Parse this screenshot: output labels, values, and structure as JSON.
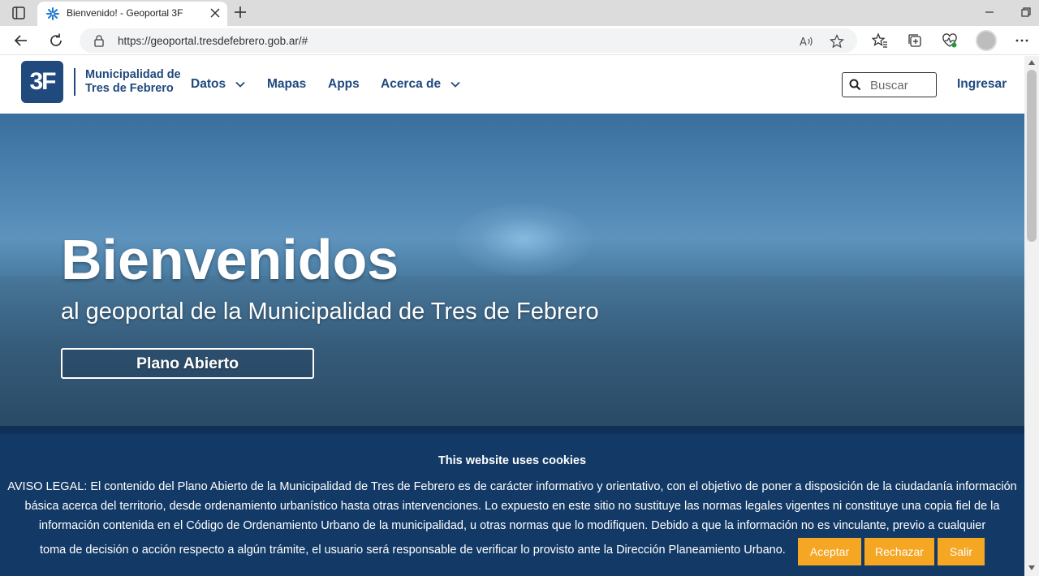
{
  "browser": {
    "tab_title": "Bienvenido! - Geoportal 3F",
    "url": "https://geoportal.tresdefebrero.gob.ar/#"
  },
  "site": {
    "logo_text": "3F",
    "org_line1": "Municipalidad de",
    "org_line2": "Tres de Febrero",
    "nav": {
      "datos": "Datos",
      "mapas": "Mapas",
      "apps": "Apps",
      "acerca": "Acerca de"
    },
    "search_placeholder": "Buscar",
    "login": "Ingresar",
    "brand_color": "#20497e"
  },
  "hero": {
    "title": "Bienvenidos",
    "subtitle": "al geoportal de la Municipalidad de Tres de Febrero",
    "button": "Plano Abierto"
  },
  "cookie_banner": {
    "title": "This website uses cookies",
    "text": "AVISO LEGAL: El contenido del Plano Abierto de la Municipalidad de Tres de Febrero es de carácter informativo y orientativo, con el objetivo de poner a disposición de la ciudadanía información básica acerca del territorio, desde ordenamiento urbanístico hasta otras intervenciones. Lo expuesto en este sitio no sustituye las normas legales vigentes ni constituye una copia fiel de la información contenida en el Código de Ordenamiento Urbano de la municipalidad, u otras normas que lo modifiquen. Debido a que la información no es vinculante, previo a cualquier",
    "text_last": "toma de decisión o acción respecto a algún trámite, el usuario será responsable de verificar lo provisto ante la Dirección Planeamiento Urbano.",
    "accept": "Aceptar",
    "reject": "Rechazar",
    "exit": "Salir",
    "background_color": "#133a66",
    "button_color": "#f5a623"
  }
}
